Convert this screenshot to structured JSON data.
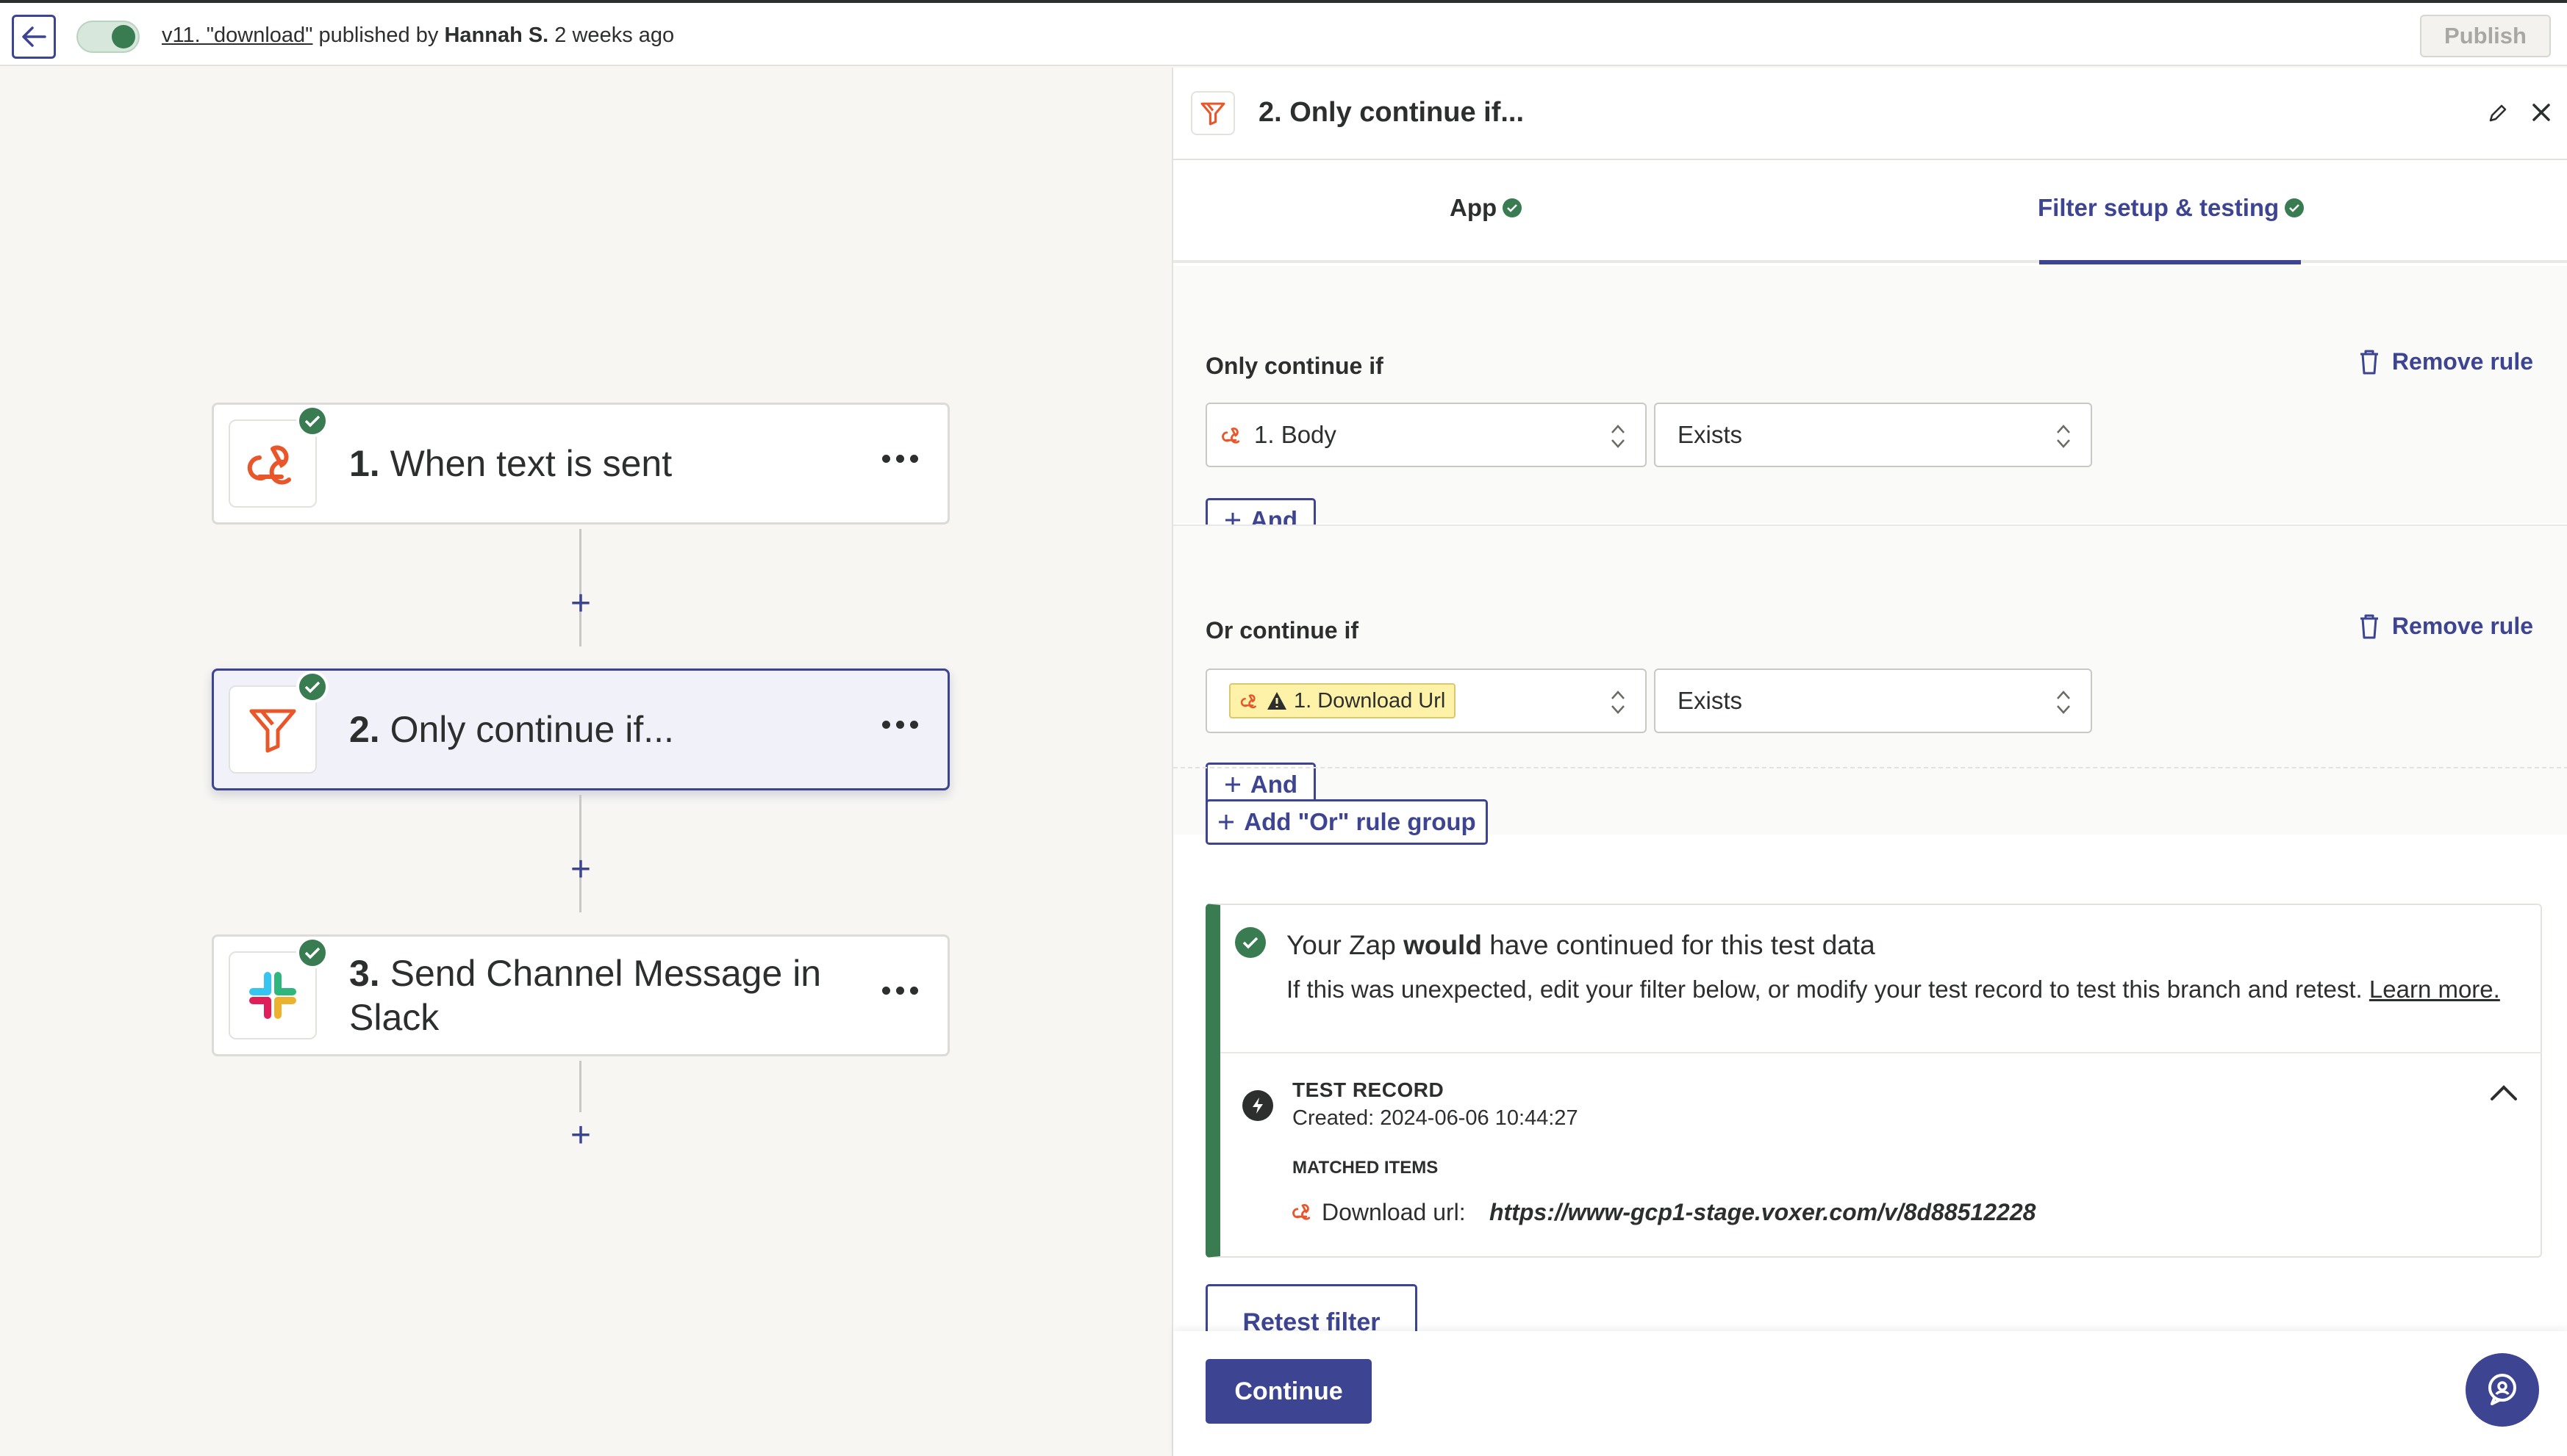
{
  "topbar": {
    "version_link": "v11. \"download\"",
    "published_by": " published by ",
    "author": "Hannah S.",
    "when": " 2 weeks ago",
    "publish_label": "Publish"
  },
  "steps": [
    {
      "number": "1.",
      "title": "When text is sent",
      "app_icon": "webhook-icon"
    },
    {
      "number": "2.",
      "title": "Only continue if...",
      "app_icon": "filter-icon"
    },
    {
      "number": "3.",
      "title_line1": "Send Channel Message in",
      "title_line2": "Slack",
      "app_icon": "slack-icon"
    }
  ],
  "add_step_label": "+",
  "panel": {
    "title": "2. Only continue if...",
    "tabs": [
      {
        "label": "App"
      },
      {
        "label": "Filter setup & testing"
      }
    ],
    "groups": [
      {
        "label": "Only continue if",
        "remove_label": "Remove rule",
        "field": "1. Body",
        "condition": "Exists",
        "and_label": "And"
      },
      {
        "label": "Or continue if",
        "remove_label": "Remove rule",
        "field": "1. Download Url",
        "condition": "Exists",
        "and_label": "And"
      }
    ],
    "add_or_group_label": "Add \"Or\" rule group",
    "result": {
      "headline_pre": "Your Zap ",
      "headline_bold": "would",
      "headline_post": " have continued for this test data",
      "sub": "If this was unexpected, edit your filter below, or modify your test record to test this branch and retest. ",
      "learn_more": "Learn more.",
      "record_title": "TEST RECORD",
      "record_created": "Created: 2024-06-06 10:44:27",
      "matched_title": "MATCHED ITEMS",
      "item_label": "Download url:",
      "item_value": "https://www-gcp1-stage.voxer.com/v/8d88512228"
    },
    "retest_label": "Retest filter",
    "continue_label": "Continue"
  },
  "colors": {
    "accent": "#3d4592",
    "success": "#3a7c52",
    "webhook_orange": "#e8562a",
    "chip_yellow": "#fdf2a8"
  }
}
